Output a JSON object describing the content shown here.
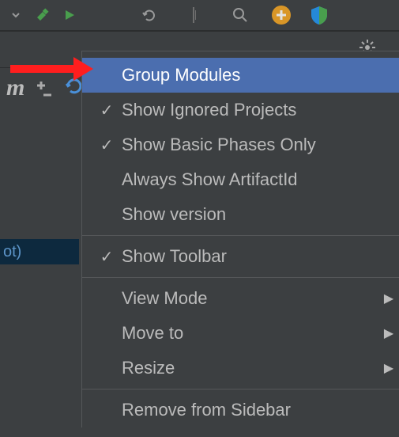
{
  "toolbar": {
    "icons": [
      "dropdown",
      "hammer",
      "run",
      "undo",
      "divider",
      "search",
      "add",
      "shield"
    ]
  },
  "left": {
    "m_label": "m",
    "selected_text": "ot)"
  },
  "menu": {
    "group_modules": "Group Modules",
    "show_ignored": "Show Ignored Projects",
    "show_basic": "Show Basic Phases Only",
    "always_artifact": "Always Show ArtifactId",
    "show_version": "Show version",
    "show_toolbar": "Show Toolbar",
    "view_mode": "View Mode",
    "move_to": "Move to",
    "resize": "Resize",
    "remove_sidebar": "Remove from Sidebar"
  }
}
